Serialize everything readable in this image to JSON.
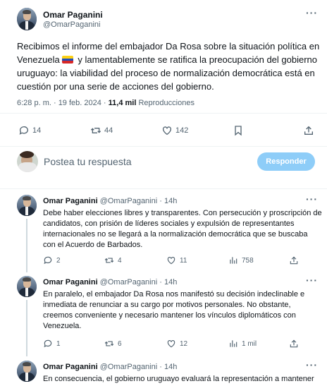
{
  "main_tweet": {
    "author_name": "Omar Paganini",
    "author_handle": "@OmarPaganini",
    "text_part1": "Recibimos el informe del embajador Da Rosa sobre la situación política en Venezuela",
    "text_part2": " y lamentablemente se ratifica la preocupación del gobierno uruguayo: la viabilidad del proceso de normalización democrática está en cuestión por una serie de acciones del gobierno.",
    "timestamp": "6:28 p. m. · 19 feb. 2024 · ",
    "views_count": "11,4 mil",
    "views_label": " Reproducciones",
    "replies": "14",
    "reposts": "44",
    "likes": "142"
  },
  "reply_composer": {
    "placeholder": "Postea tu respuesta",
    "button": "Responder"
  },
  "thread": [
    {
      "name": "Omar Paganini",
      "meta": "@OmarPaganini · 14h",
      "text": "Debe haber elecciones libres y transparentes. Con persecución y proscripción de candidatos, con prisión de líderes sociales y expulsión de representantes internacionales no se llegará a la normalización democrática que se buscaba con el Acuerdo de Barbados.",
      "replies": "2",
      "reposts": "4",
      "likes": "11",
      "views": "758"
    },
    {
      "name": "Omar Paganini",
      "meta": "@OmarPaganini · 14h",
      "text": "En paralelo, el embajador Da Rosa nos manifestó su decisión indeclinable e inmediata de renunciar a su cargo por motivos personales. No obstante, creemos conveniente y necesario mantener los vínculos diplomáticos con Venezuela.",
      "replies": "1",
      "reposts": "6",
      "likes": "12",
      "views": "1 mil"
    },
    {
      "name": "Omar Paganini",
      "meta": "@OmarPaganini · 14h",
      "text": "En consecuencia, el gobierno uruguayo evaluará la representación a mantener"
    }
  ],
  "colors": {
    "accent": "#1d9bf0",
    "reply_button": "#8ecdf8",
    "secondary_text": "#536471"
  },
  "icons": [
    "more-icon",
    "reply-icon",
    "repost-icon",
    "like-icon",
    "views-icon",
    "bookmark-icon",
    "share-icon"
  ]
}
